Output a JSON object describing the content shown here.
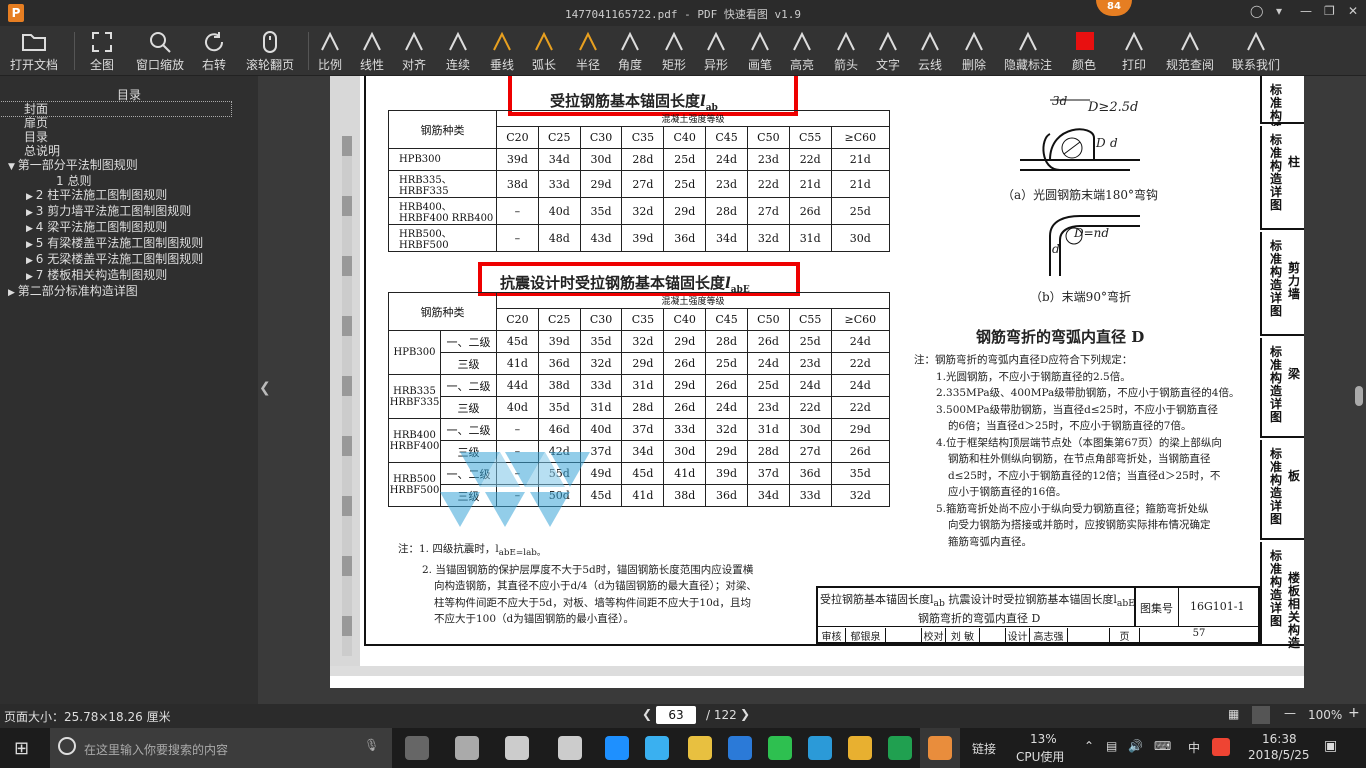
{
  "window": {
    "title": "1477041165722.pdf - PDF 快速看图 v1.9",
    "badge": "84",
    "logo": "P"
  },
  "toolbar": [
    {
      "id": "open",
      "label": "打开文档",
      "icon": "folder-icon"
    },
    {
      "id": "fit",
      "label": "全图",
      "icon": "fit-all-icon"
    },
    {
      "id": "zoom",
      "label": "窗口缩放",
      "icon": "magnifier-icon"
    },
    {
      "id": "rotate",
      "label": "右转",
      "icon": "rotate-icon"
    },
    {
      "id": "scroll",
      "label": "滚轮翻页",
      "icon": "mouse-icon"
    },
    {
      "id": "scale",
      "label": "比例",
      "icon": "ruler-icon"
    },
    {
      "id": "linear",
      "label": "线性",
      "icon": "linear-dim-icon"
    },
    {
      "id": "align",
      "label": "对齐",
      "icon": "aligned-dim-icon"
    },
    {
      "id": "cont",
      "label": "连续",
      "icon": "continuous-dim-icon"
    },
    {
      "id": "perp",
      "label": "垂线",
      "icon": "perpendicular-icon"
    },
    {
      "id": "arc",
      "label": "弧长",
      "icon": "arc-icon"
    },
    {
      "id": "radius",
      "label": "半径",
      "icon": "circle-icon"
    },
    {
      "id": "angle",
      "label": "角度",
      "icon": "angle-icon"
    },
    {
      "id": "rect",
      "label": "矩形",
      "icon": "rectangle-icon"
    },
    {
      "id": "poly",
      "label": "异形",
      "icon": "polygon-icon"
    },
    {
      "id": "pen",
      "label": "画笔",
      "icon": "pen-icon"
    },
    {
      "id": "hl",
      "label": "高亮",
      "icon": "highlighter-icon"
    },
    {
      "id": "arrow",
      "label": "箭头",
      "icon": "arrow-icon"
    },
    {
      "id": "text",
      "label": "文字",
      "icon": "text-icon"
    },
    {
      "id": "cloud",
      "label": "云线",
      "icon": "cloud-icon"
    },
    {
      "id": "erase",
      "label": "删除",
      "icon": "eraser-icon"
    },
    {
      "id": "hide",
      "label": "隐藏标注",
      "icon": "eye-hidden-icon"
    },
    {
      "id": "color",
      "label": "颜色",
      "icon": "color-swatch-icon"
    },
    {
      "id": "print",
      "label": "打印",
      "icon": "printer-icon"
    },
    {
      "id": "std",
      "label": "规范查阅",
      "icon": "book-icon"
    },
    {
      "id": "contact",
      "label": "联系我们",
      "icon": "headset-icon"
    }
  ],
  "colors": {
    "swatch": "#e81010",
    "accent": "#e67e22",
    "red_box": "#e00000"
  },
  "sidebar": {
    "title": "目录",
    "items": [
      {
        "text": "封面",
        "indent": 1,
        "arrow": ""
      },
      {
        "text": "扉页",
        "indent": 1,
        "arrow": ""
      },
      {
        "text": "目录",
        "indent": 1,
        "arrow": ""
      },
      {
        "text": "总说明",
        "indent": 1,
        "arrow": ""
      },
      {
        "text": "第一部分平法制图规则",
        "indent": 1,
        "arrow": "▼"
      },
      {
        "text": "1 总则",
        "indent": 3,
        "arrow": ""
      },
      {
        "text": "2 柱平法施工图制图规则",
        "indent": 2,
        "arrow": "▶"
      },
      {
        "text": "3 剪力墙平法施工图制图规则",
        "indent": 2,
        "arrow": "▶"
      },
      {
        "text": "4 梁平法施工图制图规则",
        "indent": 2,
        "arrow": "▶"
      },
      {
        "text": "5 有梁楼盖平法施工图制图规则",
        "indent": 2,
        "arrow": "▶"
      },
      {
        "text": "6 无梁楼盖平法施工图制图规则",
        "indent": 2,
        "arrow": "▶"
      },
      {
        "text": "7 楼板相关构造制图规则",
        "indent": 2,
        "arrow": "▶"
      },
      {
        "text": "第二部分标准构造详图",
        "indent": 1,
        "arrow": "▶"
      }
    ]
  },
  "page": {
    "title1": "受拉钢筋基本锚固长度",
    "title1_sub": "l",
    "title1_sub2": "ab",
    "table1": {
      "h1": "钢筋种类",
      "h2": "混凝土强度等级",
      "cols": [
        "C20",
        "C25",
        "C30",
        "C35",
        "C40",
        "C45",
        "C50",
        "C55",
        "≥C60"
      ],
      "rows": [
        {
          "name": "HPB300",
          "vals": [
            "39d",
            "34d",
            "30d",
            "28d",
            "25d",
            "24d",
            "23d",
            "22d",
            "21d"
          ]
        },
        {
          "name": "HRB335、HRBF335",
          "vals": [
            "38d",
            "33d",
            "29d",
            "27d",
            "25d",
            "23d",
            "22d",
            "21d",
            "21d"
          ]
        },
        {
          "name": "HRB400、HRBF400 RRB400",
          "vals": [
            "–",
            "40d",
            "35d",
            "32d",
            "29d",
            "28d",
            "27d",
            "26d",
            "25d"
          ]
        },
        {
          "name": "HRB500、HRBF500",
          "vals": [
            "–",
            "48d",
            "43d",
            "39d",
            "36d",
            "34d",
            "32d",
            "31d",
            "30d"
          ]
        }
      ]
    },
    "title2": "抗震设计时受拉钢筋基本锚固长度",
    "title2_sub": "l",
    "title2_sub2": "abE",
    "table2": {
      "h1": "钢筋种类",
      "h2": "混凝土强度等级",
      "cols": [
        "C20",
        "C25",
        "C30",
        "C35",
        "C40",
        "C45",
        "C50",
        "C55",
        "≥C60"
      ],
      "groups": [
        {
          "name": "HPB300",
          "rows": [
            {
              "grade": "一、二级",
              "vals": [
                "45d",
                "39d",
                "35d",
                "32d",
                "29d",
                "28d",
                "26d",
                "25d",
                "24d"
              ]
            },
            {
              "grade": "三级",
              "vals": [
                "41d",
                "36d",
                "32d",
                "29d",
                "26d",
                "25d",
                "24d",
                "23d",
                "22d"
              ]
            }
          ]
        },
        {
          "name": "HRB335 HRBF335",
          "rows": [
            {
              "grade": "一、二级",
              "vals": [
                "44d",
                "38d",
                "33d",
                "31d",
                "29d",
                "26d",
                "25d",
                "24d",
                "24d"
              ]
            },
            {
              "grade": "三级",
              "vals": [
                "40d",
                "35d",
                "31d",
                "28d",
                "26d",
                "24d",
                "23d",
                "22d",
                "22d"
              ]
            }
          ]
        },
        {
          "name": "HRB400 HRBF400",
          "rows": [
            {
              "grade": "一、二级",
              "vals": [
                "–",
                "46d",
                "40d",
                "37d",
                "33d",
                "32d",
                "31d",
                "30d",
                "29d"
              ]
            },
            {
              "grade": "三级",
              "vals": [
                "–",
                "42d",
                "37d",
                "34d",
                "30d",
                "29d",
                "28d",
                "27d",
                "26d"
              ]
            }
          ]
        },
        {
          "name": "HRB500 HRBF500",
          "rows": [
            {
              "grade": "一、二级",
              "vals": [
                "–",
                "55d",
                "49d",
                "45d",
                "41d",
                "39d",
                "37d",
                "36d",
                "35d"
              ]
            },
            {
              "grade": "三级",
              "vals": [
                "–",
                "50d",
                "45d",
                "41d",
                "38d",
                "36d",
                "34d",
                "33d",
                "32d"
              ]
            }
          ]
        }
      ]
    },
    "notes_left": [
      "注：1. 四级抗震时，l",
      "2. 当锚固钢筋的保护层厚度不大于5d时，锚固钢筋长度范围内应设置横",
      "向构造钢筋，其直径不应小于d/4（d为锚固钢筋的最大直径）；对梁、",
      "柱等构件间距不应大于5d，对板、墙等构件间距不应大于10d，且均",
      "不应大于100（d为锚固钢筋的最小直径）。"
    ],
    "notes_left_sub": "abE=l",
    "notes_left_sub2": "ab。",
    "fig_a_label": "（a）光圆钢筋末端180°弯钩",
    "fig_a_dim": "3d",
    "fig_a_cond": "D≥2.5d",
    "fig_a_d": "D",
    "fig_a_d2": "d",
    "fig_b_label": "（b）末端90°弯折",
    "fig_b_cond": "D=nd",
    "fig_b_d": "d",
    "bend_title": "钢筋弯折的弯弧内直径 D",
    "bend_notes": [
      "注：钢筋弯折的弯弧内直径D应符合下列规定：",
      "1.光圆钢筋，不应小于钢筋直径的2.5倍。",
      "2.335MPa级、400MPa级带肋钢筋，不应小于钢筋直径的4倍。",
      "3.500MPa级带肋钢筋，当直径d≤25时，不应小于钢筋直径",
      "的6倍；当直径d＞25时，不应小于钢筋直径的7倍。",
      "4.位于框架结构顶层端节点处（本图集第67页）的梁上部纵向",
      "钢筋和柱外侧纵向钢筋，在节点角部弯折处，当钢筋直径",
      "d≤25时，不应小于钢筋直径的12倍；当直径d＞25时，不",
      "应小于钢筋直径的16倍。",
      "5.箍筋弯折处尚不应小于纵向受力钢筋直径；箍筋弯折处纵",
      "向受力钢筋为搭接或并筋时，应按钢筋实际排布情况确定",
      "箍筋弯弧内直径。"
    ],
    "titleblock": {
      "line1": "受拉钢筋基本锚固长度l",
      "line1b": "ab",
      "line1c": " 抗震设计时受拉钢筋基本锚固长度l",
      "line1d": "abE",
      "line2": "钢筋弯折的弯弧内直径 D",
      "atlas_label": "图集号",
      "atlas": "16G101-1",
      "row2": [
        "审核",
        "郁银泉",
        "",
        "校对",
        "刘  敏",
        "",
        "设计",
        "高志强",
        "",
        "页",
        "57"
      ]
    },
    "side_tabs": [
      {
        "t": "标准构造详图",
        "sub": ""
      },
      {
        "t": "标准构造详图",
        "sub": "柱"
      },
      {
        "t": "标准构造详图",
        "sub": "剪力墙"
      },
      {
        "t": "标准构造详图",
        "sub": "梁"
      },
      {
        "t": "标准构造详图",
        "sub": "板"
      },
      {
        "t": "标准构造详图",
        "sub": "楼板相关构造"
      }
    ]
  },
  "status": {
    "page_size": "页面大小：25.78×18.26 厘米",
    "page_current": "63",
    "page_total": "/ 122",
    "zoom": "100%"
  },
  "taskbar": {
    "search_placeholder": "在这里输入你要搜索的内容",
    "link": "链接",
    "cpu": "13%",
    "cpu_label": "CPU使用",
    "ime": "中",
    "time": "16:38",
    "date": "2018/5/25"
  }
}
